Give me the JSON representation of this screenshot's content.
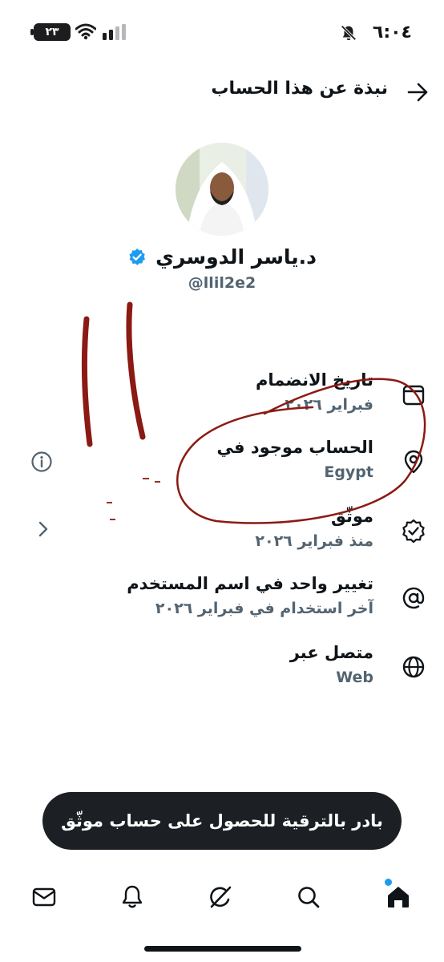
{
  "status_bar": {
    "time": "٦:٠٤",
    "battery": "٢٣"
  },
  "header": {
    "title": "نبذة عن هذا الحساب"
  },
  "profile": {
    "name": "د.ياسر الدوسري",
    "handle": "@llil2e2"
  },
  "info": [
    {
      "title": "تاريخ الانضمام",
      "value": "فبراير ٢٠٢٦",
      "icon": "calendar-icon"
    },
    {
      "title": "الحساب موجود في",
      "value": "Egypt",
      "icon": "location-pin-icon"
    },
    {
      "title": "موثّق",
      "value": "منذ فبراير ٢٠٢٦",
      "icon": "verified-check-icon"
    },
    {
      "title": "تغيير واحد في اسم المستخدم",
      "value": "آخر استخدام في فبراير ٢٠٢٦",
      "icon": "at-sign-icon"
    },
    {
      "title": "متصل عبر",
      "value": "Web",
      "icon": "globe-icon"
    }
  ],
  "banner": {
    "label": "بادر بالترقية للحصول على حساب موثّق"
  },
  "nav": [
    "home-icon",
    "search-icon",
    "grok-icon",
    "bell-icon",
    "mail-icon"
  ],
  "colors": {
    "accent": "#1d9bf0",
    "secondary_text": "#536471",
    "annotation": "#8b1a14",
    "banner_bg": "#1c1f23"
  }
}
